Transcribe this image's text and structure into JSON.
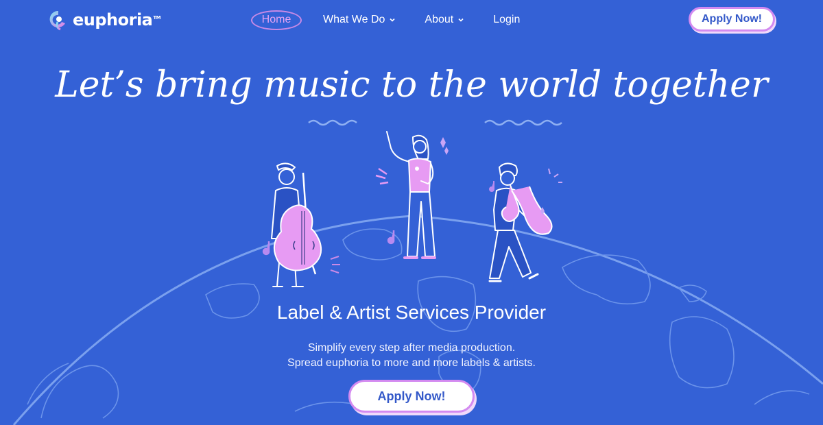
{
  "brand": {
    "name": "euphoria",
    "tm": "TM"
  },
  "nav": {
    "items": [
      {
        "label": "Home",
        "active": true
      },
      {
        "label": "What We Do",
        "has_dropdown": true
      },
      {
        "label": "About",
        "has_dropdown": true
      },
      {
        "label": "Login"
      }
    ]
  },
  "header": {
    "cta_label": "Apply Now!"
  },
  "hero": {
    "headline": "Let’s bring music to the world together",
    "subtitle": "Label & Artist Services Provider",
    "description_line1": "Simplify every step after media production.",
    "description_line2": "Spread euphoria to more and more labels & artists.",
    "cta_label": "Apply Now!"
  },
  "colors": {
    "background": "#3461d6",
    "accent_pink": "#d38af0",
    "instrument_pink": "#e79bf3",
    "button_text": "#3459c9"
  },
  "illustration": {
    "figures": [
      "bassist",
      "singer",
      "saxophonist"
    ],
    "background_shape": "globe-outline"
  }
}
